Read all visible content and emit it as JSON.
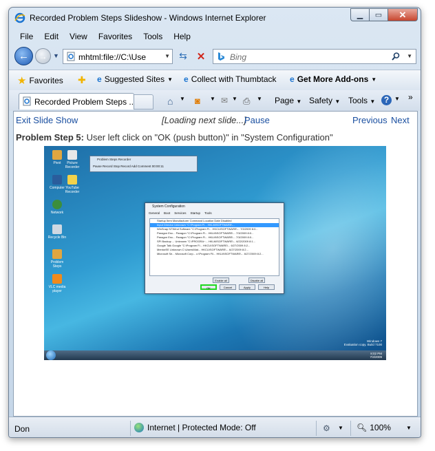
{
  "window": {
    "title": "Recorded Problem Steps Slideshow - Windows Internet Explorer"
  },
  "menu": [
    "File",
    "Edit",
    "View",
    "Favorites",
    "Tools",
    "Help"
  ],
  "address": {
    "url": "mhtml:file://C:\\Use",
    "search_placeholder": "Bing"
  },
  "favorites_bar": {
    "favorites": "Favorites",
    "suggested": "Suggested Sites",
    "thumbtack": "Collect with Thumbtack",
    "addons": "Get More Add-ons"
  },
  "tab": {
    "label": "Recorded Problem Steps ..."
  },
  "commands": {
    "page": "Page",
    "safety": "Safety",
    "tools": "Tools"
  },
  "slideshow": {
    "exit": "Exit Slide Show",
    "loading": "[Loading next slide...]",
    "pause": "Pause",
    "previous": "Previous",
    "next": "Next",
    "step_label": "Problem Step 5:",
    "step_text": " User left click on \"OK (push button)\" in \"System Configuration\""
  },
  "screenshot": {
    "desktop_icons": [
      "Pivot",
      "Picture Recorder",
      "Computer",
      "YouTube Recorder",
      "Network",
      "Recycle Bin",
      "Problem Steps",
      "VLC media player"
    ],
    "psr_title": "Problem Steps Recorder",
    "psr_buttons": "Pause Record  Stop Record  Add Comment  00:00:11",
    "syscfg_title": "System Configuration",
    "syscfg_tabs": [
      "General",
      "Boot",
      "Services",
      "Startup",
      "Tools"
    ],
    "syscfg_rows": [
      "Startup Item  Manufacturer  Command  Location  Date Disabled",
      "Input Director  Unknown  \"C:\\Program Fi...  HKLM\\SOFTWARE\\...",
      "WinSnap  NTWind Software  \"C:\\Program Fi...  HKCU\\SOFTWARE\\...  7/3/2009 8:0...",
      "Paragon Enc...  Paragon  \"C:\\Program Fi...  HKLM\\SOFTWARE\\...  7/3/2009 8:0...",
      "Paragon Enc...  Paragon  \"C:\\Program Fi...  HKLM\\SOFTWARE\\...  7/3/2009 8:0...",
      "SPI Backup ...  Unknown  \"C:\\PROGRA~...  HKLM\\SOFTWARE\\...  6/22/2009 8:1...",
      "Google Talk  Google  \"C:\\Program Fi...  HKCU\\SOFTWARE\\...  6/27/2009 8:2...",
      "MentorEE  Unknown  C:\\Users\\Mat...  HKCU\\SOFTWARE\\...  6/27/2009 8:2...",
      "Microsoft Se...  Microsoft Corp...  c:\\Program Fil...  HKLM\\SOFTWARE\\...  6/27/2009 8:2..."
    ],
    "syscfg_enable_all": "Enable all",
    "syscfg_disable_all": "Disable all",
    "syscfg_ok": "OK",
    "syscfg_cancel": "Cancel",
    "syscfg_apply": "Apply",
    "syscfg_help": "Help",
    "watermark": "Windows 7\nEvaluation copy. Build 7100",
    "clock": "8:02 PM\n7/3/2009"
  },
  "status": {
    "left": "Don",
    "zone": "Internet | Protected Mode: Off",
    "zoom": "100%"
  }
}
